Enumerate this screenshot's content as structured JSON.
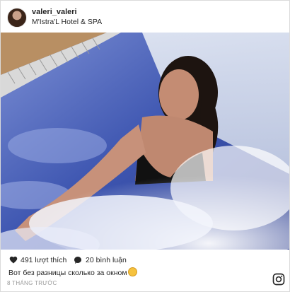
{
  "post": {
    "username": "valeri_valeri",
    "location": "M'Istra'L Hotel & SPA",
    "likes": "491 lượt thích",
    "comments": "20 bình luận",
    "caption": "Вот без разницы сколько за окном",
    "caption_emoji": "😵",
    "timestamp": "8 THÁNG TRƯỚC"
  },
  "icons": {
    "like": "heart-icon",
    "comment": "comment-bubble-icon",
    "brand": "instagram-icon"
  },
  "colors": {
    "text": "#262626",
    "muted": "#999999",
    "border": "#dbdbdb"
  }
}
